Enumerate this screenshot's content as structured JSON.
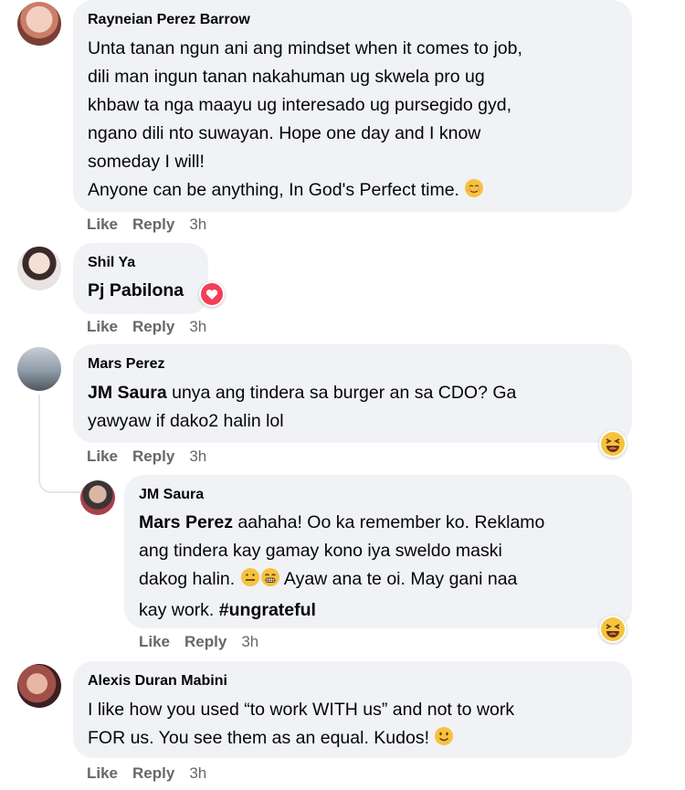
{
  "comments": [
    {
      "author": "Rayneian Perez Barrow",
      "lines": [
        "Unta tanan ngun ani ang mindset when it comes to job,",
        "dili man ingun tanan nakahuman ug skwela pro ug",
        "khbaw ta nga maayu ug interesado ug pursegido gyd,",
        "ngano dili nto suwayan. Hope one day and I know",
        "someday I will!",
        "Anyone can be anything, In God's Perfect time."
      ],
      "emoji": "relieved-face-emoji",
      "actions": {
        "like": "Like",
        "reply": "Reply",
        "time": "3h"
      }
    },
    {
      "author": "Shil Ya",
      "tag": "Pj Pabilona",
      "reaction": "love-reaction-icon",
      "actions": {
        "like": "Like",
        "reply": "Reply",
        "time": "3h"
      }
    },
    {
      "author": "Mars Perez",
      "tag": "JM Saura",
      "line1_rest": " unya ang tindera sa burger an sa CDO? Ga",
      "line2": "yawyaw if dako2 halin lol",
      "reaction": "haha-reaction-icon",
      "actions": {
        "like": "Like",
        "reply": "Reply",
        "time": "3h"
      },
      "reply": {
        "author": "JM Saura",
        "tag": "Mars Perez",
        "line1_rest": " aahaha! Oo ka remember ko. Reklamo",
        "line2": "ang tindera kay gamay kono iya sweldo maski",
        "line3_a": "dakog halin.",
        "line3_b": " Ayaw ana te oi. May gani naa",
        "line4_a": "kay work. ",
        "hashtag": "#ungrateful",
        "reaction": "haha-reaction-icon",
        "actions": {
          "like": "Like",
          "reply": "Reply",
          "time": "3h"
        }
      }
    },
    {
      "author": "Alexis Duran Mabini",
      "lines": [
        "I like how you used “to work WITH us” and not to work",
        "FOR us. You see them as an equal. Kudos!"
      ],
      "emoji": "slightly-smiling-face-emoji",
      "actions": {
        "like": "Like",
        "reply": "Reply",
        "time": "3h"
      }
    }
  ]
}
